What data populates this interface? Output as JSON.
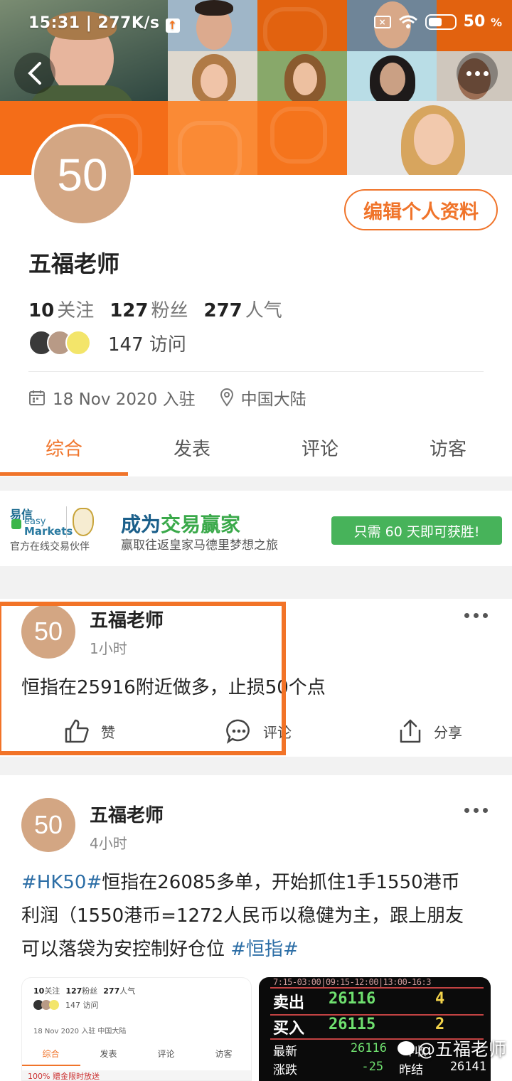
{
  "status_bar": {
    "time": "15:31",
    "network_speed": "277K/s",
    "battery_percent": "50",
    "battery_unit": "%"
  },
  "profile": {
    "avatar_text": "50",
    "name": "五福老师",
    "edit_label": "编辑个人资料",
    "stats": [
      {
        "num": "10",
        "label": "关注"
      },
      {
        "num": "127",
        "label": "粉丝"
      },
      {
        "num": "277",
        "label": "人气"
      }
    ],
    "visits_num": "147",
    "visits_label": "访问",
    "joined_date": "18 Nov 2020",
    "joined_suffix": "入驻",
    "location": "中国大陆"
  },
  "tabs": [
    {
      "label": "综合",
      "active": true
    },
    {
      "label": "发表",
      "active": false
    },
    {
      "label": "评论",
      "active": false
    },
    {
      "label": "访客",
      "active": false
    }
  ],
  "ad": {
    "logo_cn": "易信",
    "logo_easy": "easy",
    "logo_markets": "Markets",
    "partner": "官方在线交易伙伴",
    "title_part1": "成为",
    "title_part2": "交易赢家",
    "subtitle": "赢取往返皇家马德里梦想之旅",
    "cta": "只需 60 天即可获胜!"
  },
  "posts": [
    {
      "avatar_text": "50",
      "author": "五福老师",
      "time": "1小时",
      "text": "恒指在25916附近做多，止损50个点",
      "actions": {
        "like": "赞",
        "comment": "评论",
        "share": "分享"
      }
    },
    {
      "avatar_text": "50",
      "author": "五福老师",
      "time": "4小时",
      "tag1": "#HK50#",
      "line1_rest": "恒指在26085多单，开始抓住1手1550港币",
      "line2": "利润（1550港币=1272人民币以稳健为主，跟上朋友",
      "line3_pre": "可以落袋为安控制好仓位 ",
      "tag2": "#恒指#"
    }
  ],
  "thumb1": {
    "stats": [
      {
        "num": "10",
        "label": "关注"
      },
      {
        "num": "127",
        "label": "粉丝"
      },
      {
        "num": "277",
        "label": "人气"
      }
    ],
    "visits": "147 访问",
    "meta": "18 Nov 2020 入驻   中国大陆",
    "tabs": [
      "综合",
      "发表",
      "评论",
      "访客"
    ],
    "ad_snippet": "100% 赠金限时放送"
  },
  "thumb2": {
    "header": "7:15-03:00|09:15-12:00|13:00-16:3",
    "sell_label": "卖出",
    "sell_price": "26116",
    "sell_qty": "4",
    "buy_label": "买入",
    "buy_price": "26115",
    "buy_qty": "2",
    "latest_label": "最新",
    "latest_val": "26116",
    "prev_label": "昨收",
    "change_label": "涨跌",
    "change_val": "-25",
    "settle_label": "昨结",
    "settle_val": "26141"
  },
  "watermark": "@五福老师",
  "colors": {
    "accent": "#f0742a",
    "cover_orange": "#f5741c",
    "avatar_bg": "#d3a683",
    "hashtag": "#2c6ea6",
    "ad_green": "#47b35a"
  }
}
